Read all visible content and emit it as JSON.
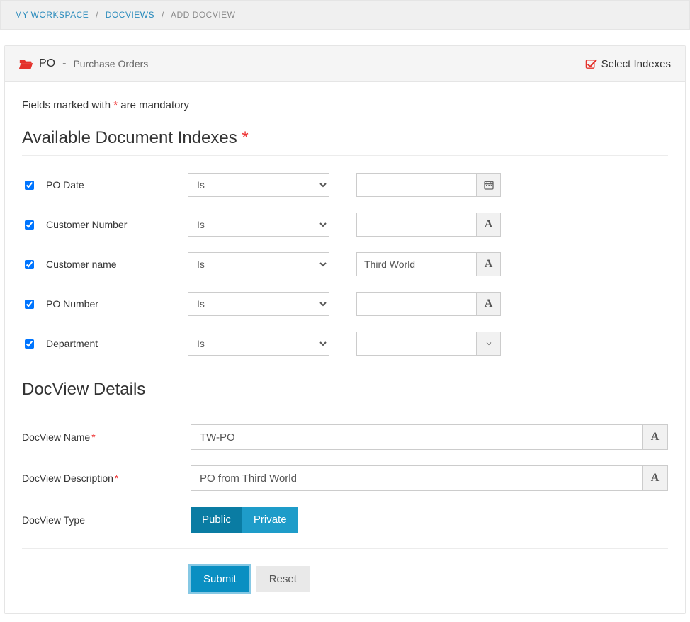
{
  "breadcrumb": {
    "items": [
      "My Workspace",
      "DocViews",
      "Add DocView"
    ]
  },
  "header": {
    "code": "PO",
    "dash": "-",
    "label": "Purchase Orders",
    "select_indexes": "Select Indexes"
  },
  "note": {
    "prefix": "Fields marked with ",
    "ast": "*",
    "suffix": " are mandatory"
  },
  "sections": {
    "indexes_title": "Available Document Indexes",
    "details_title": "DocView Details"
  },
  "operator_option": "Is",
  "indexes": [
    {
      "name": "PO Date",
      "checked": true,
      "operator": "Is",
      "value": "",
      "kind": "date"
    },
    {
      "name": "Customer Number",
      "checked": true,
      "operator": "Is",
      "value": "",
      "kind": "text"
    },
    {
      "name": "Customer name",
      "checked": true,
      "operator": "Is",
      "value": "Third World",
      "kind": "text"
    },
    {
      "name": "PO Number",
      "checked": true,
      "operator": "Is",
      "value": "",
      "kind": "text"
    },
    {
      "name": "Department",
      "checked": true,
      "operator": "Is",
      "value": "",
      "kind": "select"
    }
  ],
  "details": {
    "name_label": "DocView Name",
    "name_value": "TW-PO",
    "desc_label": "DocView Description",
    "desc_value": "PO from Third World",
    "type_label": "DocView Type",
    "type_options": [
      "Public",
      "Private"
    ],
    "type_active_index": 0
  },
  "buttons": {
    "submit": "Submit",
    "reset": "Reset"
  }
}
